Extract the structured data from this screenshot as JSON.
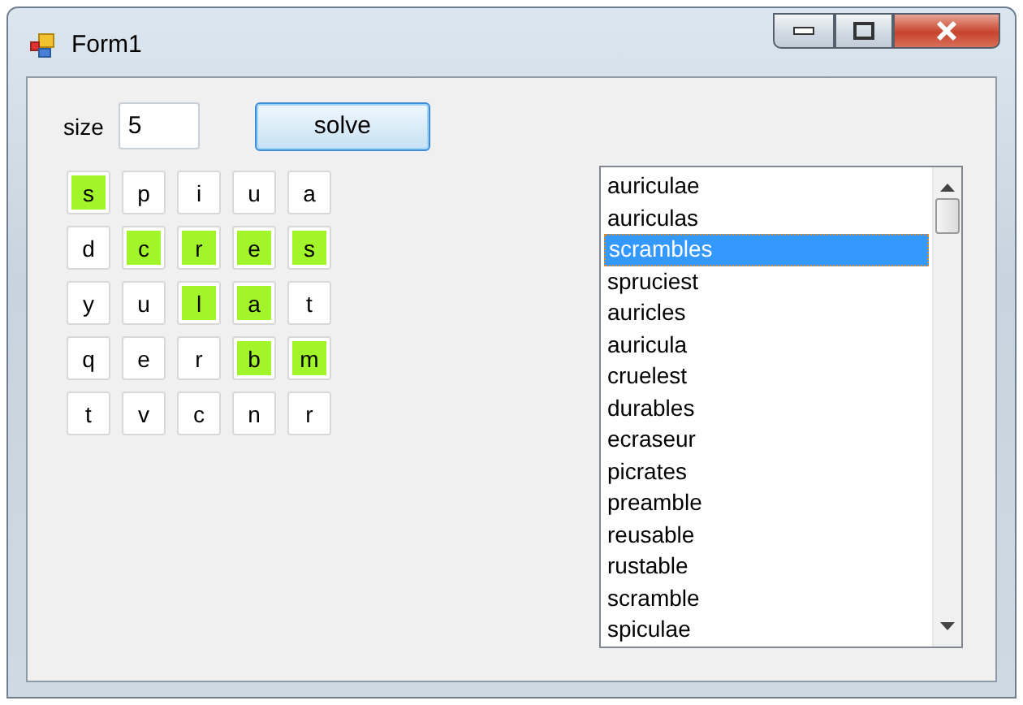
{
  "window": {
    "title": "Form1"
  },
  "size": {
    "label": "size",
    "value": "5"
  },
  "solve_button": "solve",
  "grid": [
    [
      {
        "letter": "s",
        "highlighted": true
      },
      {
        "letter": "p",
        "highlighted": false
      },
      {
        "letter": "i",
        "highlighted": false
      },
      {
        "letter": "u",
        "highlighted": false
      },
      {
        "letter": "a",
        "highlighted": false
      }
    ],
    [
      {
        "letter": "d",
        "highlighted": false
      },
      {
        "letter": "c",
        "highlighted": true
      },
      {
        "letter": "r",
        "highlighted": true
      },
      {
        "letter": "e",
        "highlighted": true
      },
      {
        "letter": "s",
        "highlighted": true
      }
    ],
    [
      {
        "letter": "y",
        "highlighted": false
      },
      {
        "letter": "u",
        "highlighted": false
      },
      {
        "letter": "l",
        "highlighted": true
      },
      {
        "letter": "a",
        "highlighted": true
      },
      {
        "letter": "t",
        "highlighted": false
      }
    ],
    [
      {
        "letter": "q",
        "highlighted": false
      },
      {
        "letter": "e",
        "highlighted": false
      },
      {
        "letter": "r",
        "highlighted": false
      },
      {
        "letter": "b",
        "highlighted": true
      },
      {
        "letter": "m",
        "highlighted": true
      }
    ],
    [
      {
        "letter": "t",
        "highlighted": false
      },
      {
        "letter": "v",
        "highlighted": false
      },
      {
        "letter": "c",
        "highlighted": false
      },
      {
        "letter": "n",
        "highlighted": false
      },
      {
        "letter": "r",
        "highlighted": false
      }
    ]
  ],
  "words": [
    {
      "text": "auriculae",
      "selected": false
    },
    {
      "text": "auriculas",
      "selected": false
    },
    {
      "text": "scrambles",
      "selected": true
    },
    {
      "text": "spruciest",
      "selected": false
    },
    {
      "text": "auricles",
      "selected": false
    },
    {
      "text": "auricula",
      "selected": false
    },
    {
      "text": "cruelest",
      "selected": false
    },
    {
      "text": "durables",
      "selected": false
    },
    {
      "text": "ecraseur",
      "selected": false
    },
    {
      "text": "picrates",
      "selected": false
    },
    {
      "text": "preamble",
      "selected": false
    },
    {
      "text": "reusable",
      "selected": false
    },
    {
      "text": "rustable",
      "selected": false
    },
    {
      "text": "scramble",
      "selected": false
    },
    {
      "text": "spiculae",
      "selected": false
    }
  ]
}
